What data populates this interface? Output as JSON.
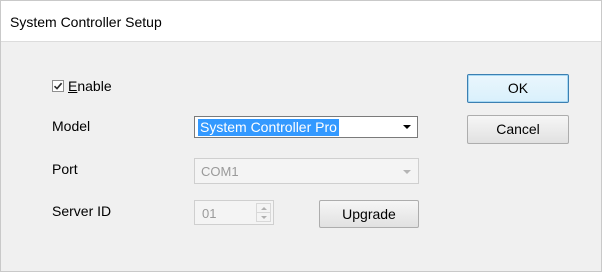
{
  "window": {
    "title": "System Controller Setup"
  },
  "enable": {
    "checked": true,
    "label_underlined": "E",
    "label_rest": "nable"
  },
  "labels": {
    "model": "Model",
    "port": "Port",
    "server_id": "Server ID"
  },
  "model": {
    "value": "System Controller Pro"
  },
  "port": {
    "value": "COM1",
    "disabled": true
  },
  "server_id": {
    "value": "01",
    "disabled": true
  },
  "buttons": {
    "ok": "OK",
    "cancel": "Cancel",
    "upgrade": "Upgrade"
  }
}
